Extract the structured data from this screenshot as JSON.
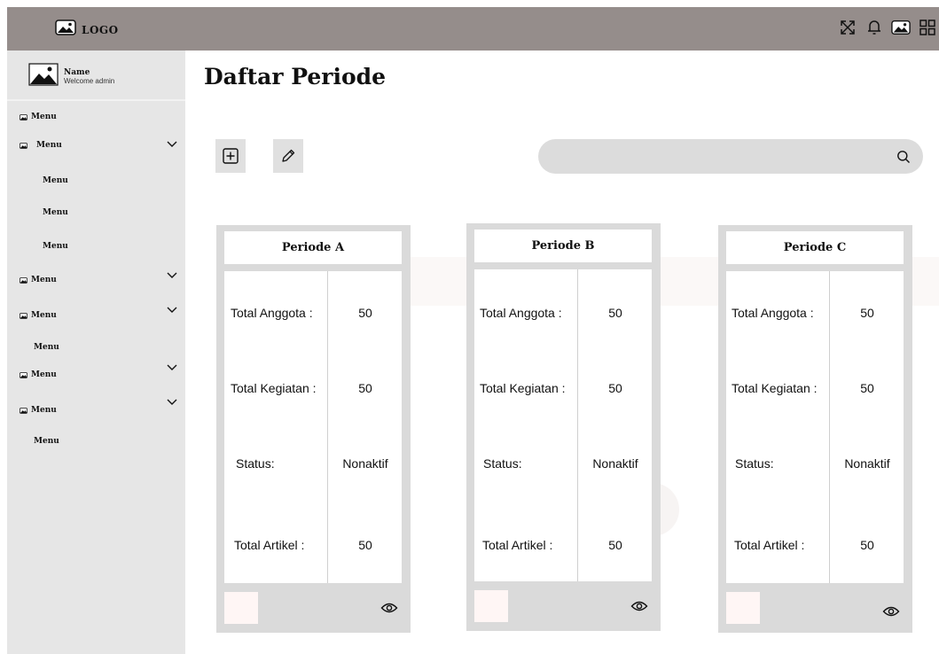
{
  "header": {
    "logo_text": "LOGO",
    "icons": [
      "expand-icon",
      "bell-icon",
      "image-icon",
      "grid-icon"
    ]
  },
  "sidebar": {
    "profile": {
      "name": "Name",
      "subtitle": "Welcome admin"
    },
    "items": [
      {
        "label": "Menu",
        "has_icon": true,
        "expandable": false
      },
      {
        "label": "Menu",
        "has_icon": true,
        "expandable": true
      },
      {
        "label": "Menu",
        "has_icon": false,
        "expandable": false
      },
      {
        "label": "Menu",
        "has_icon": false,
        "expandable": false
      },
      {
        "label": "Menu",
        "has_icon": false,
        "expandable": false
      },
      {
        "label": "Menu",
        "has_icon": true,
        "expandable": true
      },
      {
        "label": "Menu",
        "has_icon": true,
        "expandable": true
      },
      {
        "label": "Menu",
        "has_icon": false,
        "expandable": false
      },
      {
        "label": "Menu",
        "has_icon": true,
        "expandable": true
      },
      {
        "label": "Menu",
        "has_icon": true,
        "expandable": true
      },
      {
        "label": "Menu",
        "has_icon": false,
        "expandable": false
      }
    ]
  },
  "main": {
    "title": "Daftar Periode",
    "search": {
      "placeholder": ""
    },
    "cards": [
      {
        "title": "Periode A",
        "rows": [
          {
            "label": "Total Anggota :",
            "value": "50"
          },
          {
            "label": "Total Kegiatan :",
            "value": "50"
          },
          {
            "label": "Status:",
            "value": "Nonaktif"
          },
          {
            "label": "Total Artikel :",
            "value": "50"
          }
        ]
      },
      {
        "title": "Periode B",
        "rows": [
          {
            "label": "Total Anggota :",
            "value": "50"
          },
          {
            "label": "Total Kegiatan :",
            "value": "50"
          },
          {
            "label": "Status:",
            "value": "Nonaktif"
          },
          {
            "label": "Total Artikel :",
            "value": "50"
          }
        ]
      },
      {
        "title": "Periode C",
        "rows": [
          {
            "label": "Total Anggota :",
            "value": "50"
          },
          {
            "label": "Total Kegiatan :",
            "value": "50"
          },
          {
            "label": "Status:",
            "value": "Nonaktif"
          },
          {
            "label": "Total Artikel :",
            "value": "50"
          }
        ]
      }
    ]
  },
  "colors": {
    "topbar": "#958d8b",
    "sidebar": "#e6e6e6",
    "card_frame": "#dadada",
    "search_bg": "#dcdcdc"
  }
}
